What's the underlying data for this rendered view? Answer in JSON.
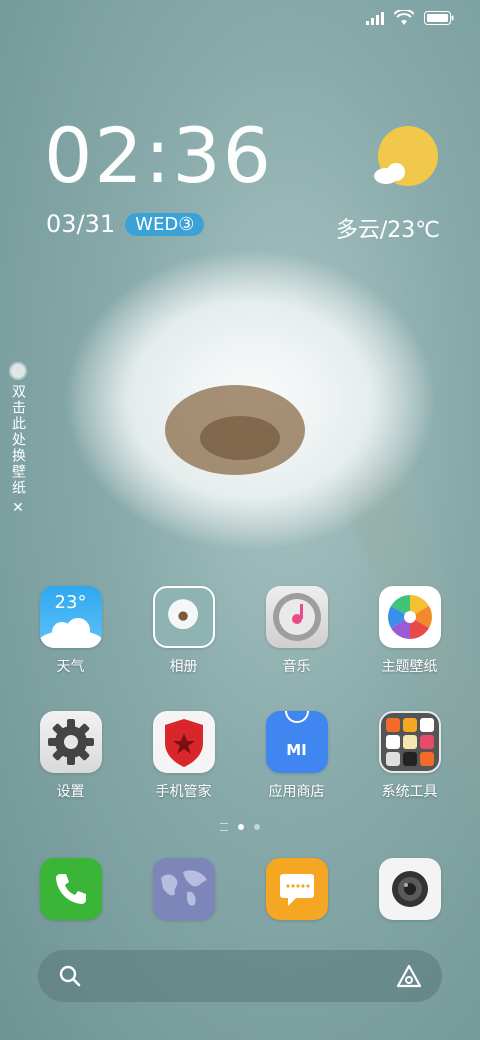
{
  "status": {
    "signal": "signal-icon",
    "wifi": "wifi-icon",
    "battery": "battery-icon"
  },
  "clock": {
    "time": "02:36",
    "date": "03/31",
    "weekday": "WED③"
  },
  "weather": {
    "icon": "partly-cloudy-icon",
    "text": "多云/23℃"
  },
  "wallpaper_switch": {
    "label": "双击此处换壁纸",
    "close": "✕"
  },
  "apps_row1": [
    {
      "name": "weather",
      "label": "天气",
      "badge": "23°"
    },
    {
      "name": "gallery",
      "label": "相册"
    },
    {
      "name": "music",
      "label": "音乐"
    },
    {
      "name": "themes",
      "label": "主题壁纸"
    }
  ],
  "apps_row2": [
    {
      "name": "settings",
      "label": "设置"
    },
    {
      "name": "security",
      "label": "手机管家"
    },
    {
      "name": "app-store",
      "label": "应用商店",
      "badge": "MI"
    },
    {
      "name": "system-tools",
      "label": "系统工具"
    }
  ],
  "dock": [
    {
      "name": "phone"
    },
    {
      "name": "browser"
    },
    {
      "name": "messages"
    },
    {
      "name": "camera"
    }
  ],
  "search": {
    "icon": "search-icon",
    "assistant": "assistant-icon"
  },
  "colors": {
    "accent": "#3aa2d6",
    "sun": "#f2c84b"
  }
}
